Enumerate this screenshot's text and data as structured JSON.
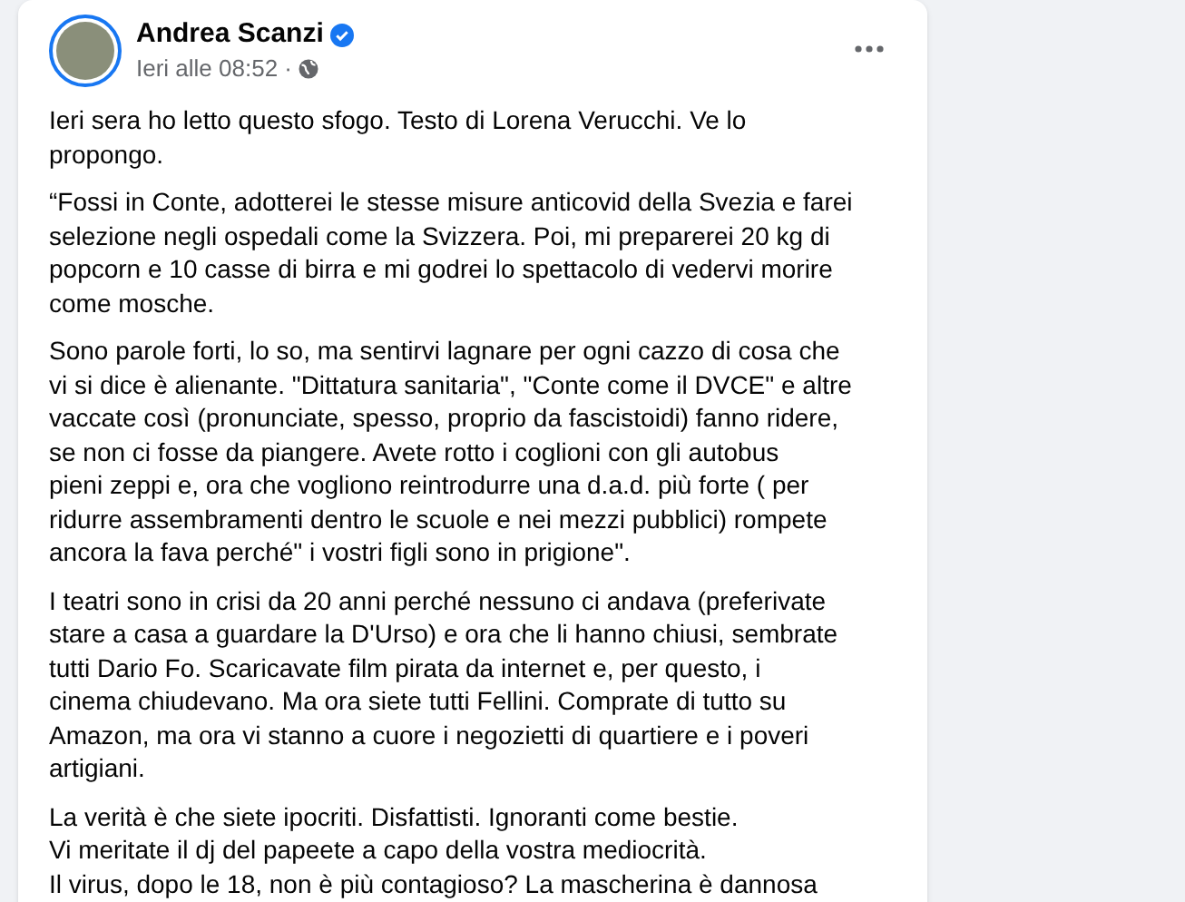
{
  "post": {
    "author": "Andrea Scanzi",
    "verified": true,
    "timestamp": "Ieri alle 08:52 ·",
    "paragraphs": [
      [
        "Ieri sera ho letto questo sfogo. Testo di Lorena Verucchi. Ve lo",
        "propongo."
      ],
      [
        "“Fossi in Conte, adotterei le stesse misure anticovid della Svezia e farei",
        "selezione negli ospedali come la Svizzera. Poi, mi preparerei 20 kg di",
        "popcorn e 10 casse di birra e mi godrei lo spettacolo di vedervi morire",
        "come mosche."
      ],
      [
        "Sono parole forti, lo so, ma sentirvi lagnare per ogni cazzo di cosa che",
        "vi si dice è alienante. \"Dittatura sanitaria\", \"Conte come il DVCE\" e altre",
        "vaccate così (pronunciate, spesso, proprio da fascistoidi) fanno ridere,",
        "se non ci fosse da piangere. Avete rotto i coglioni con gli autobus",
        "pieni zeppi e, ora che vogliono reintrodurre una d.a.d. più forte ( per",
        "ridurre assembramenti dentro le scuole e nei mezzi pubblici) rompete",
        "ancora la fava perché\" i vostri figli sono in prigione\"."
      ],
      [
        "I teatri sono in crisi da 20 anni perché nessuno ci andava (preferivate",
        "stare a casa a guardare la D'Urso) e ora che li hanno chiusi, sembrate",
        "tutti Dario Fo. Scaricavate film pirata da internet e, per questo, i",
        "cinema chiudevano. Ma ora siete tutti Fellini. Comprate di tutto su",
        "Amazon, ma ora vi stanno a cuore i negozietti di quartiere e i poveri",
        "artigiani."
      ],
      [
        "La verità è che siete ipocriti. Disfattisti. Ignoranti come bestie.",
        "Vi meritate il dj del papeete a capo della vostra mediocrità.",
        "Il virus, dopo le 18, non è più contagioso? La mascherina è dannosa"
      ]
    ]
  }
}
